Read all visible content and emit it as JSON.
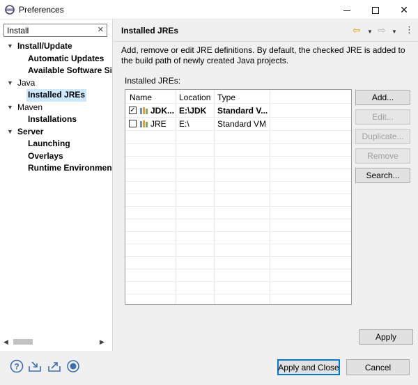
{
  "window": {
    "title": "Preferences",
    "minimize_icon": "minimize-icon",
    "maximize_icon": "maximize-icon",
    "close_glyph": "✕"
  },
  "filter": {
    "value": "Install",
    "clear_glyph": "✕"
  },
  "tree": [
    {
      "label": "Install/Update",
      "expanded": true,
      "bold": true
    },
    {
      "label": "Automatic Updates",
      "bold": true
    },
    {
      "label": "Available Software Si",
      "bold": true
    },
    {
      "label": "Java",
      "expanded": true,
      "bold": false
    },
    {
      "label": "Installed JREs",
      "bold": true,
      "selected": true
    },
    {
      "label": "Maven",
      "expanded": true,
      "bold": false
    },
    {
      "label": "Installations",
      "bold": true
    },
    {
      "label": "Server",
      "expanded": true,
      "bold": true
    },
    {
      "label": "Launching",
      "bold": true
    },
    {
      "label": "Overlays",
      "bold": true
    },
    {
      "label": "Runtime Environmen",
      "bold": true
    }
  ],
  "page": {
    "title": "Installed JREs",
    "description": "Add, remove or edit JRE definitions. By default, the checked JRE is added to the build path of newly created Java projects.",
    "section_label": "Installed JREs:"
  },
  "table": {
    "columns": [
      "Name",
      "Location",
      "Type"
    ],
    "rows": [
      {
        "checked": true,
        "name": "JDK...",
        "location": "E:\\JDK",
        "type": "Standard V...",
        "bold": true
      },
      {
        "checked": false,
        "name": "JRE",
        "location": "E:\\",
        "type": "Standard VM",
        "bold": false
      }
    ]
  },
  "buttons": {
    "add": "Add...",
    "edit": "Edit...",
    "duplicate": "Duplicate...",
    "remove": "Remove",
    "search": "Search...",
    "apply": "Apply",
    "apply_close": "Apply and Close",
    "cancel": "Cancel"
  },
  "icons": {
    "back": "back-arrow-icon",
    "forward": "forward-arrow-icon",
    "view_menu": "view-menu-icon",
    "help": "help-icon",
    "import": "import-icon",
    "export": "export-icon",
    "record": "record-icon"
  },
  "colors": {
    "accent": "#0078d7",
    "selection": "#cce8ff",
    "back_arrow": "#e8a200"
  }
}
